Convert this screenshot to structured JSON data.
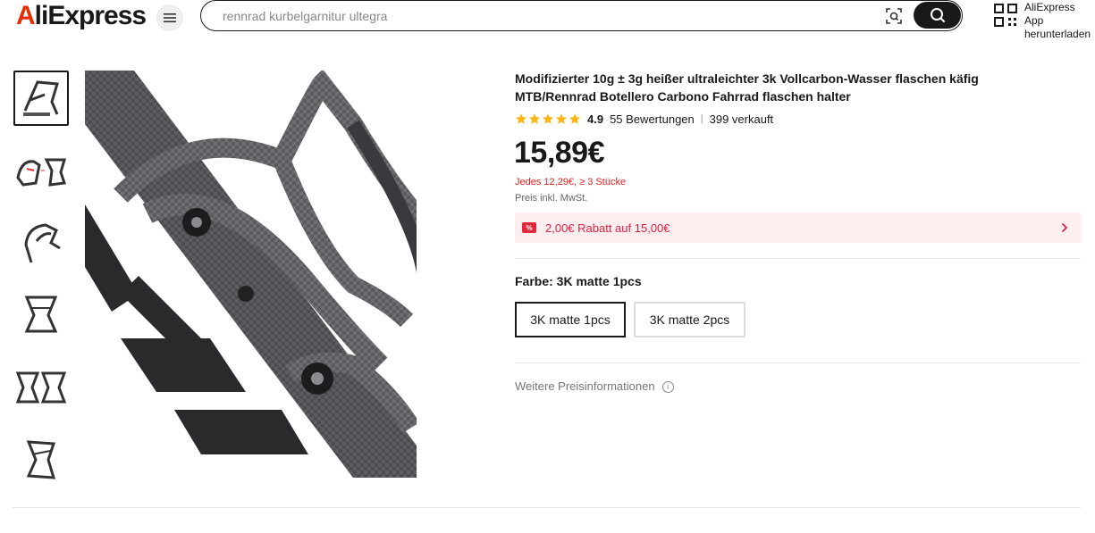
{
  "header": {
    "logo_a": "A",
    "logo_rest": "liExpress",
    "search_placeholder": "rennrad kurbelgarnitur ultegra",
    "app_line1": "AliExpress App",
    "app_line2": "herunterladen"
  },
  "gallery": {
    "thumbnails": [
      "cage-front-thumb",
      "cage-pair-thumb",
      "cage-side-thumb",
      "cage-front-thumb",
      "cage-pair-front-thumb",
      "cage-angle-thumb"
    ],
    "selected_index": 0
  },
  "product": {
    "title": "Modifizierter 10g ± 3g heißer ultraleichter 3k Vollcarbon-Wasser flaschen käfig MTB/Rennrad Botellero Carbono Fahrrad flaschen halter",
    "rating": "4.9",
    "reviews": "55 Bewertungen",
    "sold": "399 verkauft",
    "stars": 5,
    "price": "15,89€",
    "tier_price": "Jedes 12,29€, ≥ 3 Stücke",
    "vat_note": "Preis inkl. MwSt.",
    "coupon": "2,00€ Rabatt auf 15,00€",
    "color_label": "Farbe: 3K matte 1pcs",
    "options": [
      "3K matte 1pcs",
      "3K matte 2pcs"
    ],
    "selected_option": 0,
    "more_info": "Weitere Preisinformationen"
  },
  "colors": {
    "brand": "#e62e04",
    "star": "#fdb515",
    "coupon_bg": "#fdeef0",
    "coupon_text": "#e02040",
    "tier_text": "#e02020"
  }
}
